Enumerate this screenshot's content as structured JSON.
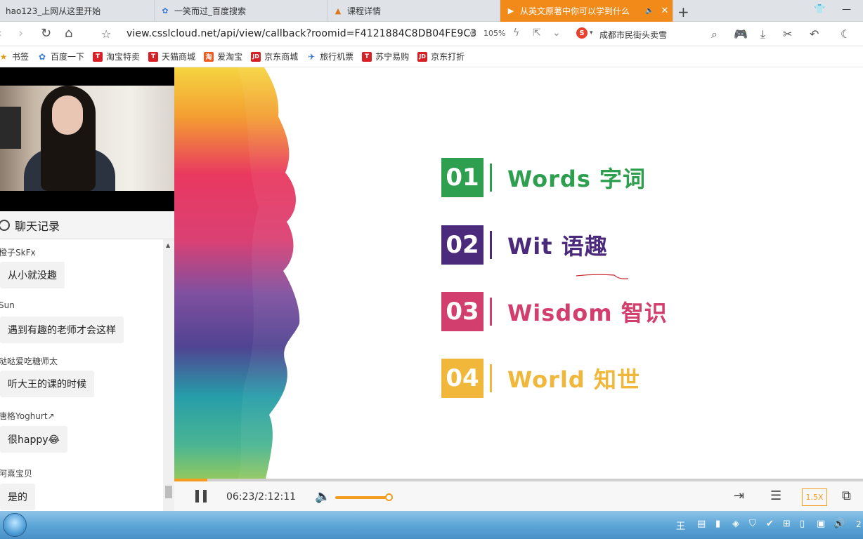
{
  "tabs": [
    {
      "title": "hao123_上网从这里开始",
      "active": false
    },
    {
      "title": "一笑而过_百度搜索",
      "active": false
    },
    {
      "title": "课程详情",
      "active": false
    },
    {
      "title": "从英文原著中你可以学到什么",
      "active": true
    }
  ],
  "address": {
    "url": "view.csslcloud.net/api/view/callback?roomid=F4121884C8DB04FE9C3",
    "zoom": "105%",
    "search_hot": "成都市民街头卖雪"
  },
  "bookmarks": [
    {
      "label": "书签",
      "icon": "bookmark-icon"
    },
    {
      "label": "百度一下",
      "icon": "baidu-paw-icon"
    },
    {
      "label": "淘宝特卖",
      "icon": "tmall-icon"
    },
    {
      "label": "天猫商城",
      "icon": "tmall-icon"
    },
    {
      "label": "爱淘宝",
      "icon": "taobao-icon"
    },
    {
      "label": "京东商城",
      "icon": "jd-icon"
    },
    {
      "label": "旅行机票",
      "icon": "plane-icon"
    },
    {
      "label": "苏宁易购",
      "icon": "suning-icon"
    },
    {
      "label": "京东打折",
      "icon": "jd-icon"
    }
  ],
  "chat": {
    "title": "聊天记录",
    "messages": [
      {
        "user": "橙子SkFx",
        "text": "从小就没趣"
      },
      {
        "user": "Sun",
        "text": "遇到有趣的老师才会这样"
      },
      {
        "user": "哒哒爱吃糖师太",
        "text": "听大王的课的时候"
      },
      {
        "user": "唐格Yoghurt↗",
        "text": "很happy😂"
      },
      {
        "user": "阿熹宝贝",
        "text": "是的"
      }
    ]
  },
  "slide": {
    "items": [
      {
        "num": "01",
        "label": "Words  字词",
        "color": "#2e9e4f"
      },
      {
        "num": "02",
        "label": "Wit  语趣",
        "color": "#4b2a7b"
      },
      {
        "num": "03",
        "label": "Wisdom 智识",
        "color": "#d23f6e"
      },
      {
        "num": "04",
        "label": "World 知世",
        "color": "#f0b73a"
      }
    ]
  },
  "player": {
    "time": "06:23/2:12:11",
    "progress": 0.048,
    "volume": 0.9,
    "speed": "1.5X"
  },
  "taskbar": {
    "clock": "2"
  }
}
